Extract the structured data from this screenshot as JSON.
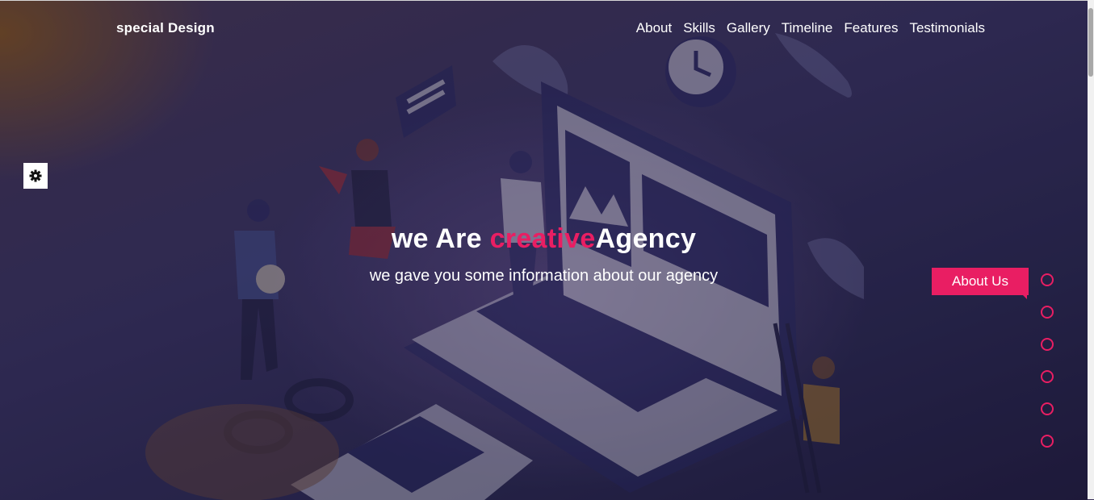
{
  "brand": {
    "logo_text": "special Design"
  },
  "nav": {
    "items": [
      {
        "label": "About"
      },
      {
        "label": "Skills"
      },
      {
        "label": "Gallery"
      },
      {
        "label": "Timeline"
      },
      {
        "label": "Features"
      },
      {
        "label": "Testimonials"
      }
    ]
  },
  "hero": {
    "title_part1": "we Are ",
    "title_accent": "creative",
    "title_part2": "Agency",
    "subtitle": "we gave you some information about our agency"
  },
  "settings": {
    "icon": "gear-icon"
  },
  "bullets_nav": {
    "tooltip": "About Us",
    "count": 6
  },
  "colors": {
    "accent": "#e91e63",
    "text": "#ffffff",
    "background": "#3b3563"
  }
}
